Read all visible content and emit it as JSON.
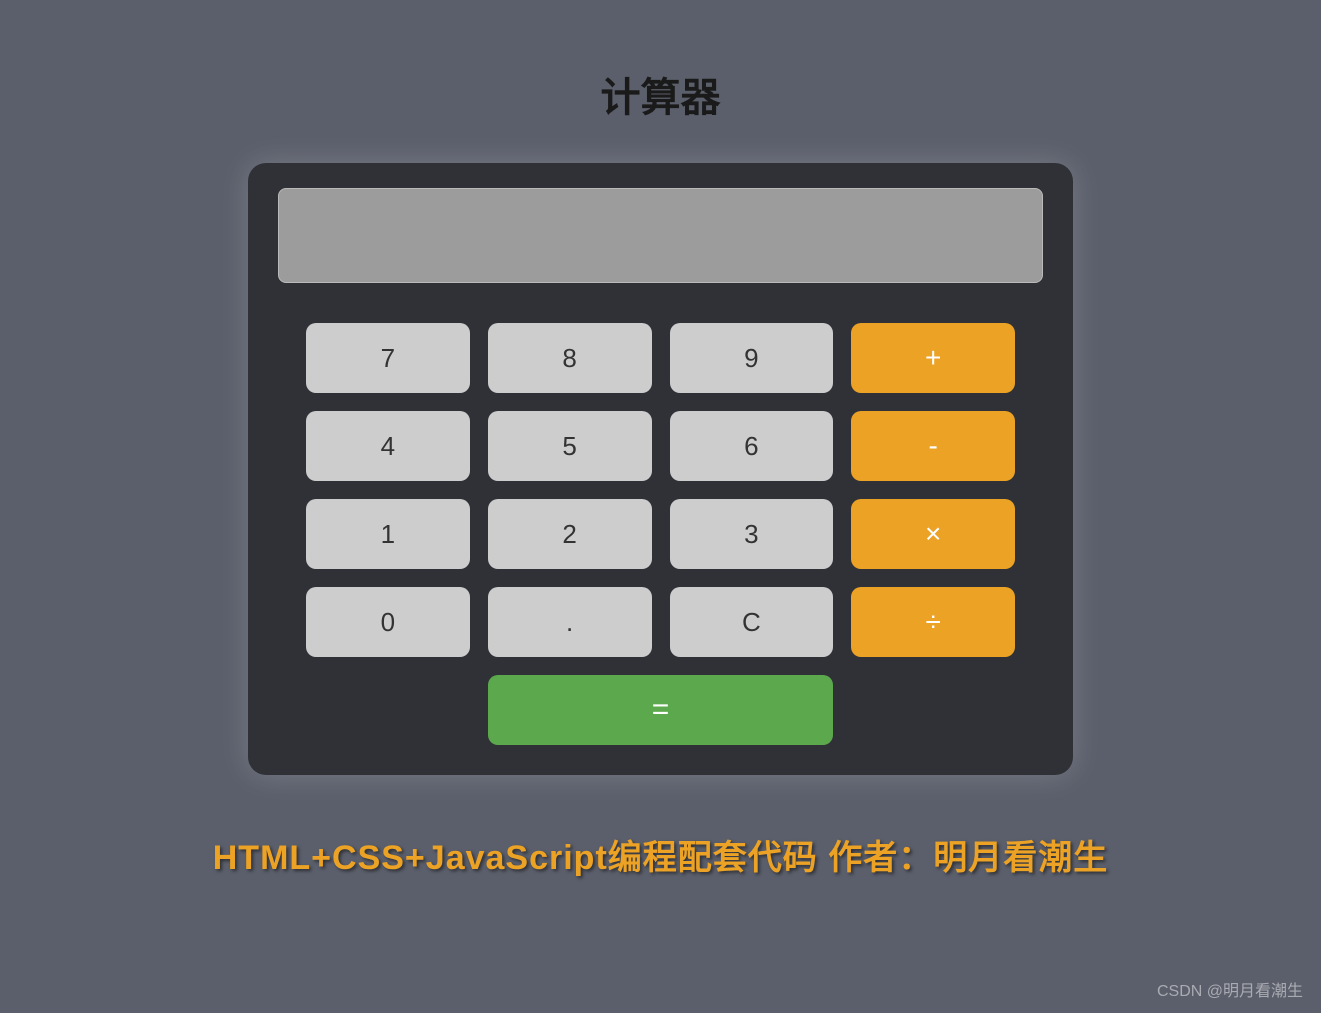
{
  "title": "计算器",
  "display": "",
  "buttons": {
    "row1": {
      "seven": "7",
      "eight": "8",
      "nine": "9",
      "plus": "+"
    },
    "row2": {
      "four": "4",
      "five": "5",
      "six": "6",
      "minus": "-"
    },
    "row3": {
      "one": "1",
      "two": "2",
      "three": "3",
      "multiply": "×"
    },
    "row4": {
      "zero": "0",
      "decimal": ".",
      "clear": "C",
      "divide": "÷"
    },
    "equals": "="
  },
  "footer": "HTML+CSS+JavaScript编程配套代码 作者：明月看潮生",
  "watermark": "CSDN @明月看潮生",
  "colors": {
    "background": "#5b5f6b",
    "calculator": "#2f3136",
    "display": "#9c9c9c",
    "numberButton": "#cdcdcd",
    "operatorButton": "#eca224",
    "equalsButton": "#5ca94d"
  }
}
